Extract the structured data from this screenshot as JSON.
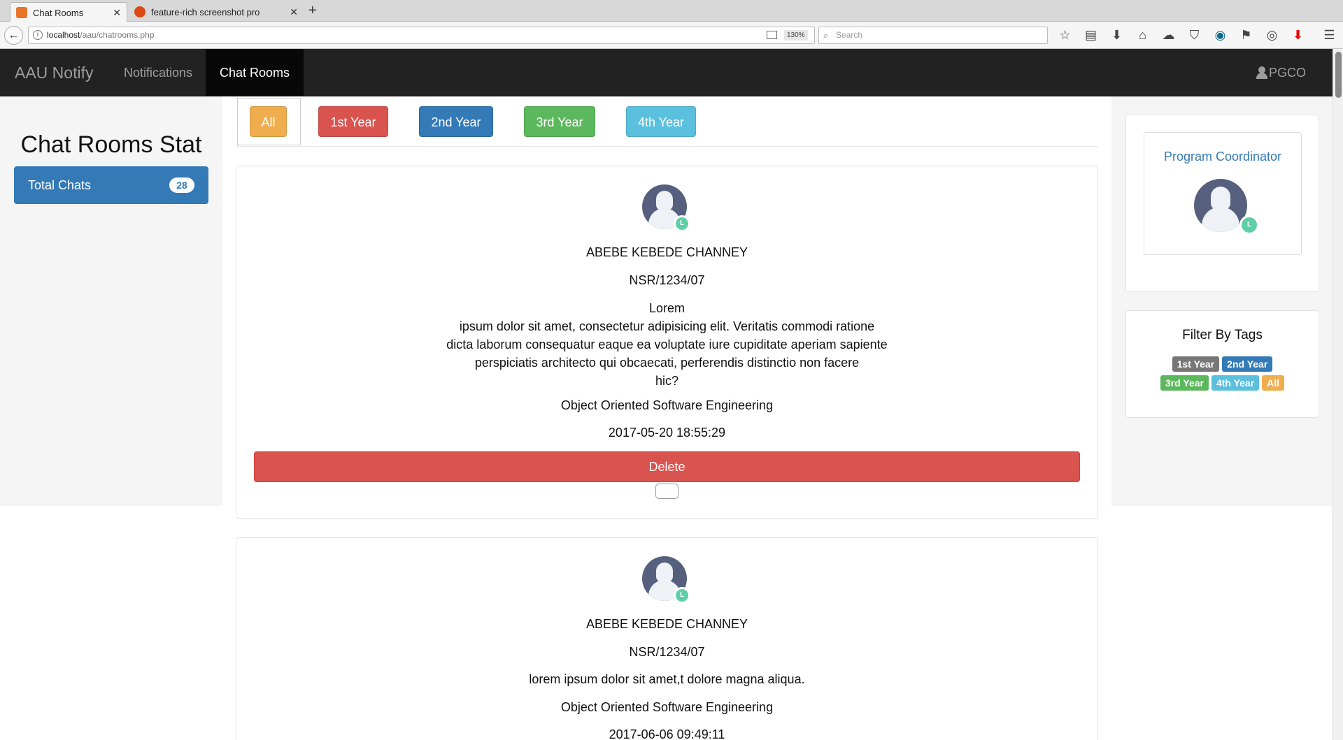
{
  "browser": {
    "tabs": [
      {
        "title": "Chat Rooms",
        "active": true
      },
      {
        "title": "feature-rich screenshot pro",
        "active": false
      }
    ],
    "url_host": "localhost",
    "url_path": "/aau/chatrooms.php",
    "zoom": "130%",
    "search_placeholder": "Search"
  },
  "nav": {
    "brand": "AAU Notify",
    "links": [
      "Notifications",
      "Chat Rooms"
    ],
    "active_link": "Chat Rooms",
    "user": "PGCO"
  },
  "sidebar": {
    "title": "Chat Rooms Stat",
    "total_label": "Total Chats",
    "total_count": "28"
  },
  "filters": [
    "All",
    "1st Year",
    "2nd Year",
    "3rd Year",
    "4th Year"
  ],
  "chats": [
    {
      "name": "ABEBE KEBEDE CHANNEY",
      "id": "NSR/1234/07",
      "message_lines": [
        "Lorem",
        "ipsum dolor sit amet, consectetur adipisicing elit. Veritatis commodi ratione",
        "dicta laborum consequatur eaque ea voluptate iure cupiditate aperiam sapiente",
        "perspiciatis architecto qui obcaecati, perferendis distinctio non facere",
        "hic?"
      ],
      "course": "Object Oriented Software Engineering",
      "timestamp": "2017-05-20 18:55:29",
      "delete_label": "Delete"
    },
    {
      "name": "ABEBE KEBEDE CHANNEY",
      "id": "NSR/1234/07",
      "message_lines": [
        "lorem ipsum dolor sit amet,t dolore magna aliqua."
      ],
      "course": "Object Oriented Software Engineering",
      "timestamp": "2017-06-06 09:49:11"
    }
  ],
  "right_sidebar": {
    "coordinator_title": "Program Coordinator",
    "tags_title": "Filter By Tags",
    "tags": [
      "1st Year",
      "2nd Year",
      "3rd Year",
      "4th Year",
      "All"
    ]
  },
  "colors": {
    "primary": "#337ab7",
    "danger": "#d9534f",
    "warning": "#f0ad4e",
    "success": "#5cb85c",
    "info": "#5bc0de",
    "navbar": "#222222"
  }
}
